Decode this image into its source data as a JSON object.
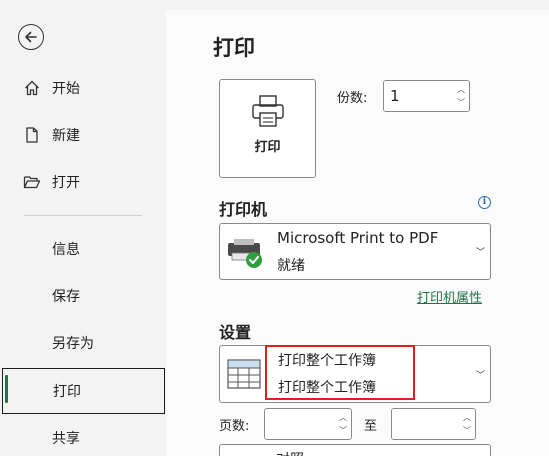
{
  "sidebar": {
    "items": [
      {
        "label": "开始",
        "icon": "home-icon"
      },
      {
        "label": "新建",
        "icon": "new-document-icon"
      },
      {
        "label": "打开",
        "icon": "open-folder-icon"
      },
      {
        "label": "信息"
      },
      {
        "label": "保存"
      },
      {
        "label": "另存为"
      },
      {
        "label": "打印",
        "active": true
      },
      {
        "label": "共享"
      }
    ]
  },
  "main": {
    "title": "打印",
    "print_button_label": "打印",
    "copies": {
      "label": "份数:",
      "value": "1"
    },
    "printer": {
      "section_title": "打印机",
      "name": "Microsoft Print to PDF",
      "status": "就绪",
      "properties_link": "打印机属性"
    },
    "settings": {
      "section_title": "设置",
      "selected_primary": "打印整个工作簿",
      "selected_secondary": "打印整个工作簿"
    },
    "pages": {
      "label": "页数:",
      "to_label": "至",
      "from_value": "",
      "to_value": ""
    },
    "bottom_partial_text": "对照"
  },
  "colors": {
    "accent": "#217346",
    "highlight": "#e02020",
    "info": "#2b6cb0"
  }
}
